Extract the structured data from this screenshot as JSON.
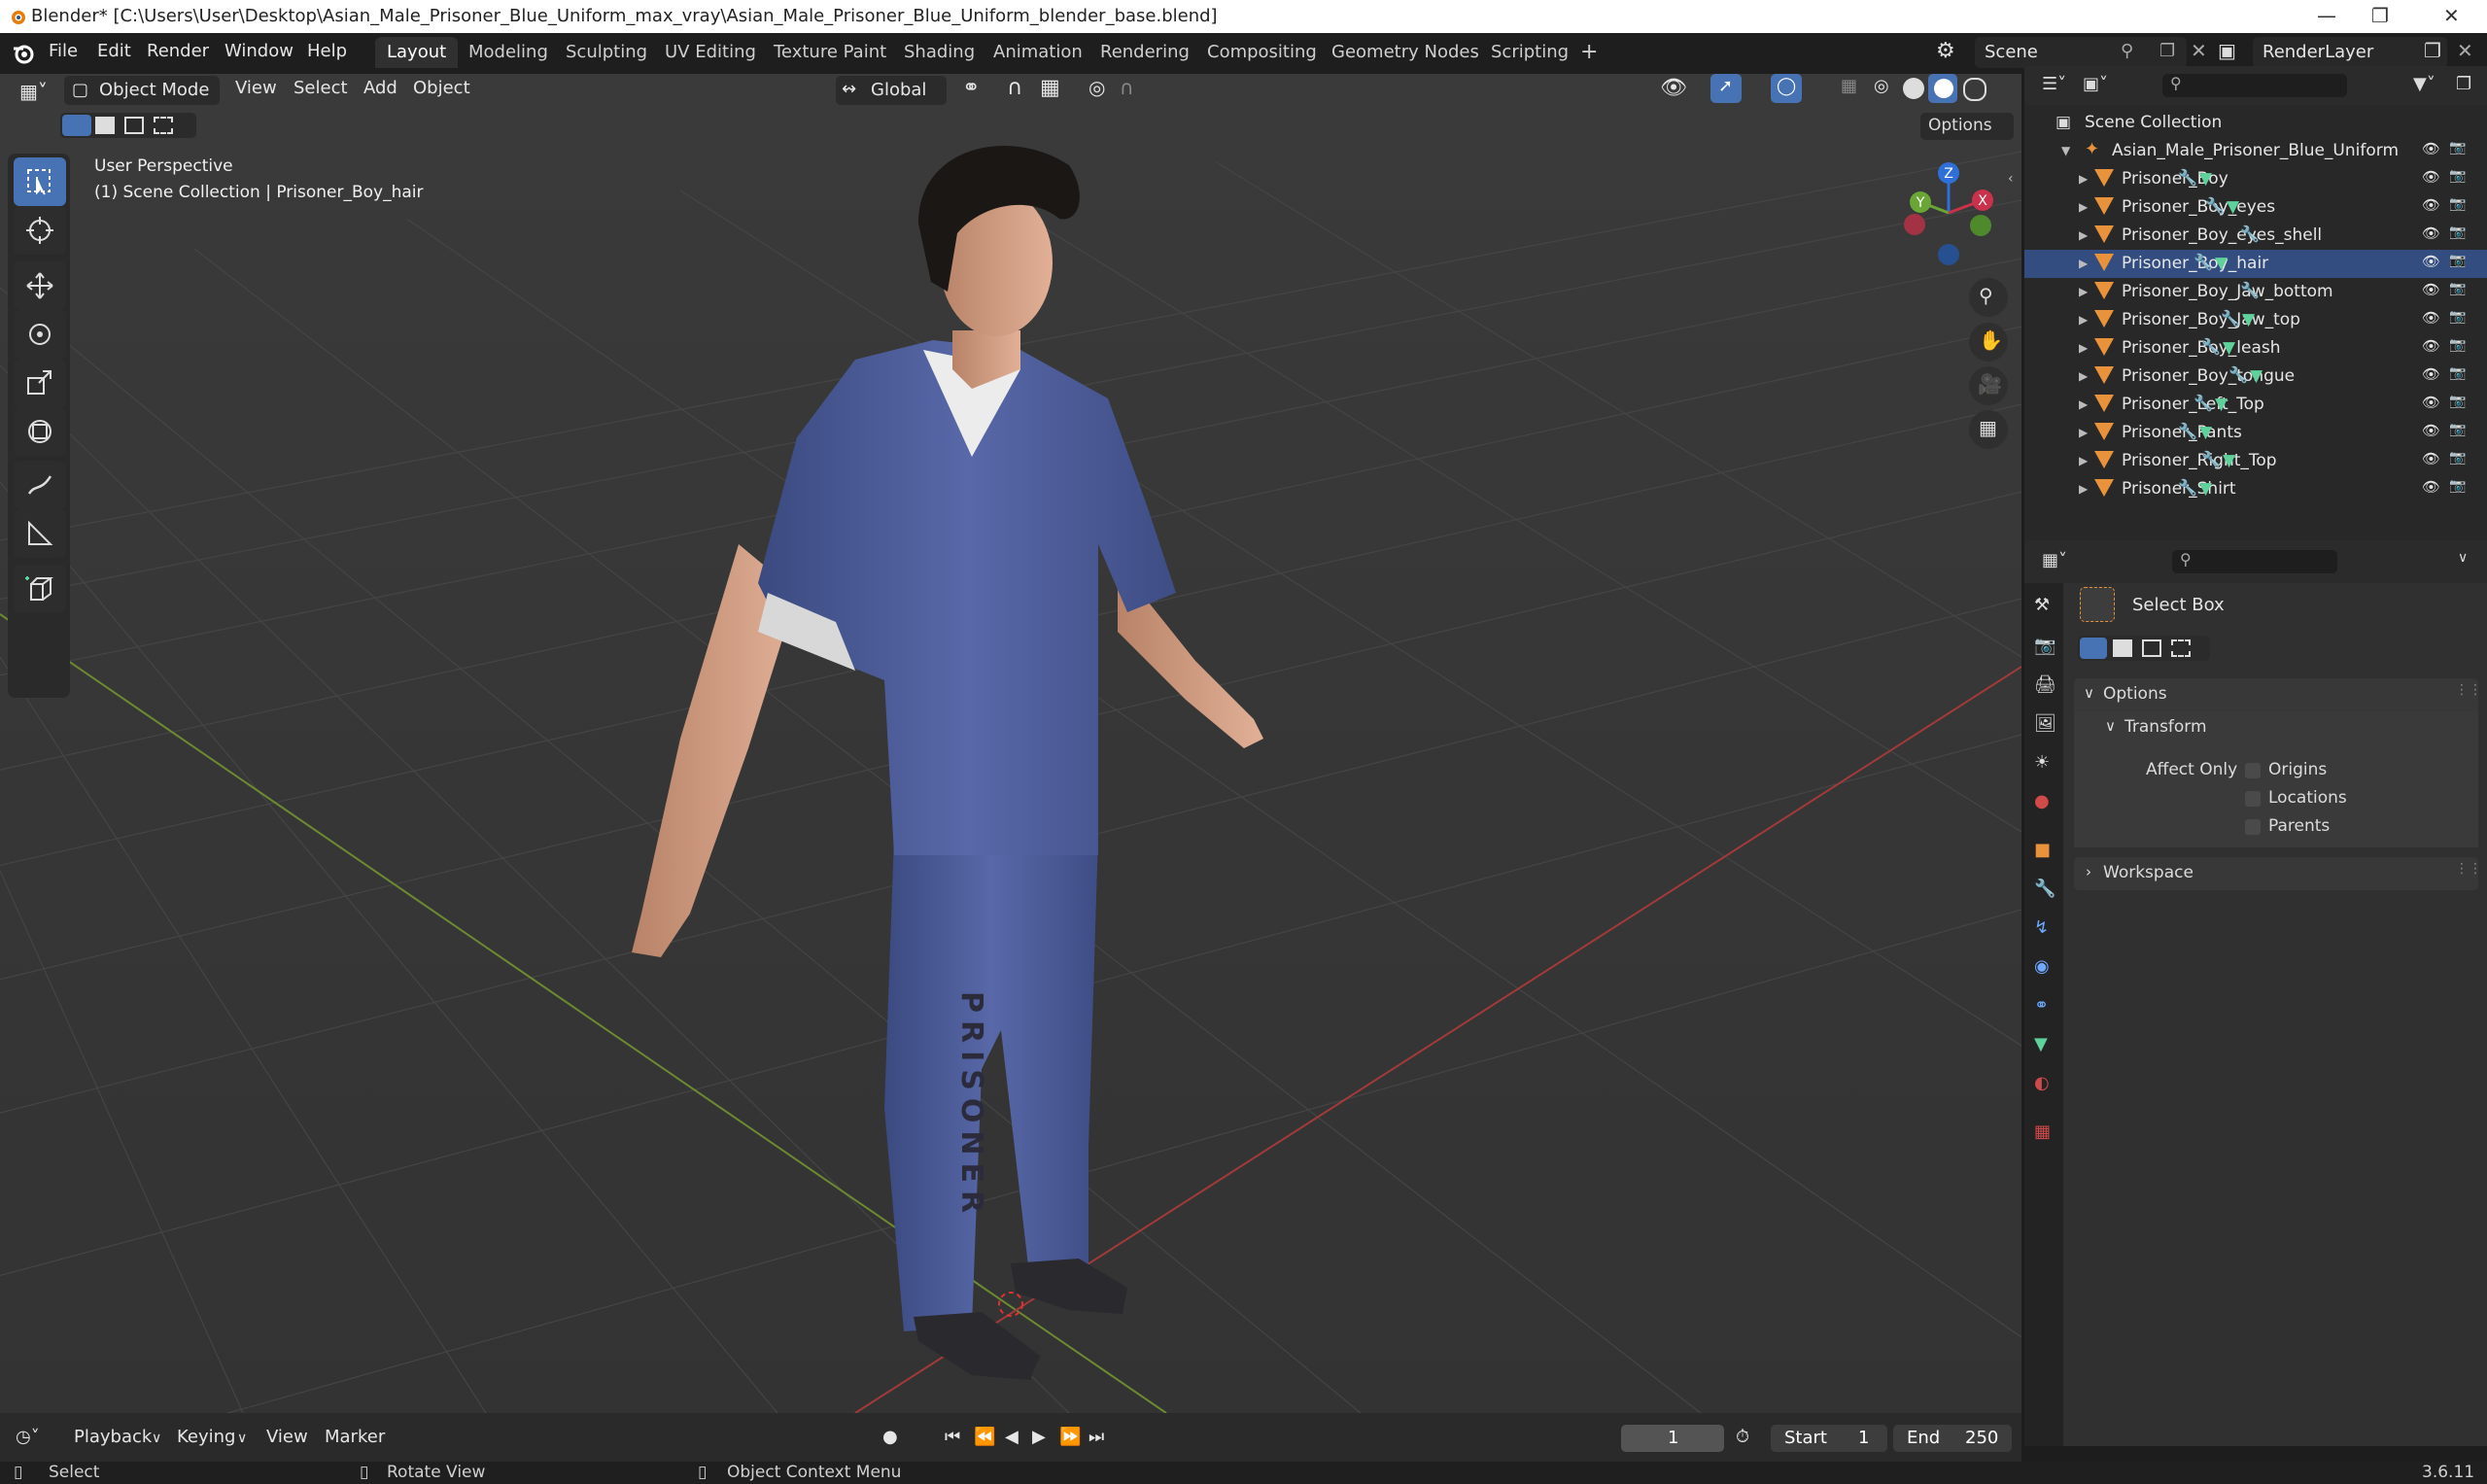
{
  "titlebar": {
    "title": "Blender* [C:\\Users\\User\\Desktop\\Asian_Male_Prisoner_Blue_Uniform_max_vray\\Asian_Male_Prisoner_Blue_Uniform_blender_base.blend]"
  },
  "menus": [
    "File",
    "Edit",
    "Render",
    "Window",
    "Help"
  ],
  "workspace_tabs": [
    "Layout",
    "Modeling",
    "Sculpting",
    "UV Editing",
    "Texture Paint",
    "Shading",
    "Animation",
    "Rendering",
    "Compositing",
    "Geometry Nodes",
    "Scripting"
  ],
  "add_tab": "+",
  "scene": {
    "name": "Scene",
    "layer": "RenderLayer"
  },
  "viewport_header": {
    "mode": "Object Mode",
    "menus": [
      "View",
      "Select",
      "Add",
      "Object"
    ],
    "orientation": "Global",
    "options": "Options"
  },
  "viewport_info": {
    "line1": "User Perspective",
    "line2": "(1) Scene Collection | Prisoner_Boy_hair"
  },
  "gizmo": {
    "z": "Z",
    "y": "Y",
    "x": "X"
  },
  "outliner": {
    "root": "Scene Collection",
    "collection": "Asian_Male_Prisoner_Blue_Uniform",
    "items": [
      "Prisoner_Boy",
      "Prisoner_Boy_eyes",
      "Prisoner_Boy_eyes_shell",
      "Prisoner_Boy_hair",
      "Prisoner_Boy_Jaw_bottom",
      "Prisoner_Boy_Jaw_top",
      "Prisoner_Boy_leash",
      "Prisoner_Boy_tongue",
      "Prisoner_Left_Top",
      "Prisoner_Pants",
      "Prisoner_Right_Top",
      "Prisoner_Shirt"
    ]
  },
  "properties": {
    "tool_name": "Select Box",
    "options_label": "Options",
    "transform_label": "Transform",
    "affect_only": "Affect Only",
    "checkboxes": [
      "Origins",
      "Locations",
      "Parents"
    ],
    "workspace_label": "Workspace"
  },
  "timeline": {
    "menus": [
      "Playback",
      "Keying",
      "View",
      "Marker"
    ],
    "current_frame": "1",
    "start_label": "Start",
    "start": "1",
    "end_label": "End",
    "end": "250"
  },
  "statusbar": {
    "select": "Select",
    "rotate": "Rotate View",
    "context": "Object Context Menu",
    "version": "3.6.11"
  },
  "uniform_text": "PRISONER",
  "colors": {
    "accent": "#4772b3",
    "mesh_icon": "#e8933b",
    "modifier_icon": "#6fa8ff",
    "vertex_group_icon": "#5fd19a",
    "uniform": "#4f5f9a"
  }
}
